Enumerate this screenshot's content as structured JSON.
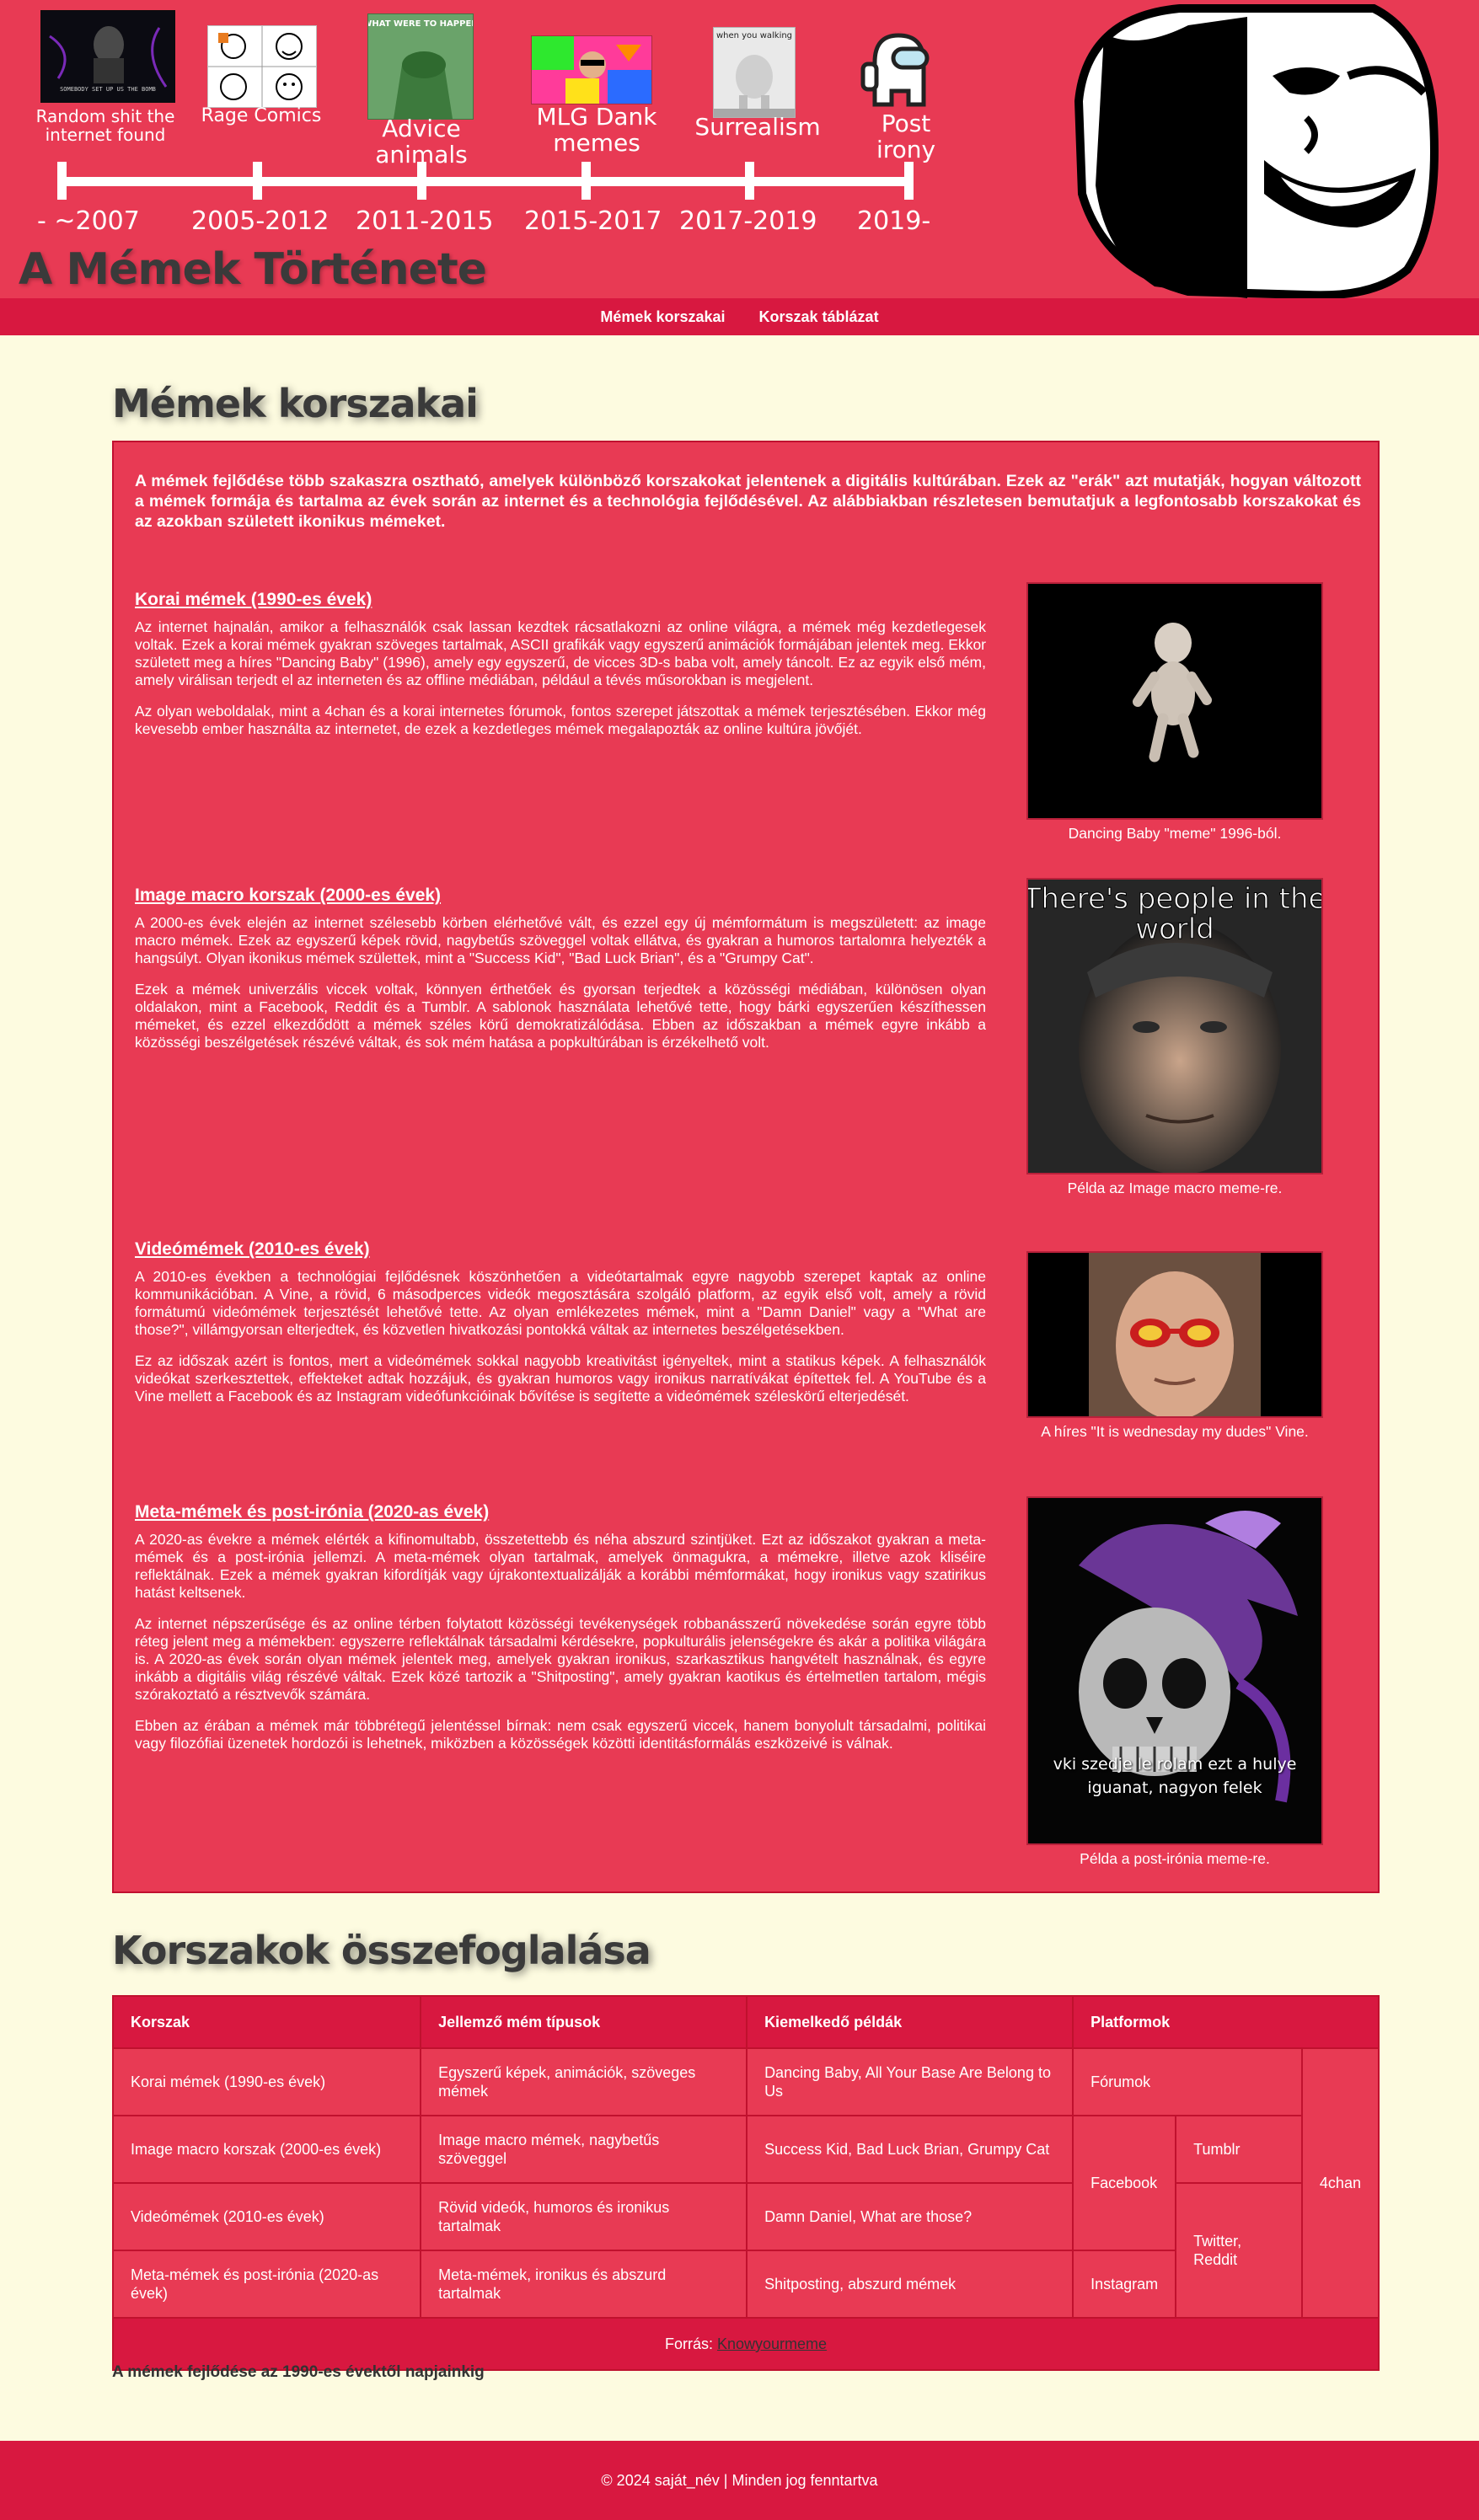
{
  "header": {
    "site_title": "A Mémek Története",
    "timeline": [
      {
        "label": "Random shit the internet found",
        "year": "- ~2007",
        "thumb_caption": "SOMEBODY SET UP US THE BOMB"
      },
      {
        "label": "Rage Comics",
        "year": "2005-2012"
      },
      {
        "label": "Advice animals",
        "year": "2011-2015",
        "thumb_caption": "WHAT WERE TO HAPPEN"
      },
      {
        "label": "MLG Dank memes",
        "year": "2015-2017"
      },
      {
        "label": "Surrealism",
        "year": "2017-2019",
        "thumb_caption": "when you walking"
      },
      {
        "label": "Post irony",
        "year": "2019-"
      }
    ]
  },
  "nav": {
    "items": [
      "Mémek korszakai",
      "Korszak táblázat"
    ]
  },
  "eras_section": {
    "title": "Mémek korszakai",
    "intro": "A mémek fejlődése több szakaszra osztható, amelyek különböző korszakokat jelentenek a digitális kultúrában. Ezek az \"erák\" azt mutatják, hogyan változott a mémek formája és tartalma az évek során az internet és a technológia fejlődésével. Az alábbiakban részletesen bemutatjuk a legfontosabb korszakokat és az azokban született ikonikus mémeket.",
    "eras": [
      {
        "heading": "Korai mémek (1990-es évek)",
        "paragraphs": [
          "Az internet hajnalán, amikor a felhasználók csak lassan kezdtek rácsatlakozni az online világra, a mémek még kezdetlegesek voltak. Ezek a korai mémek gyakran szöveges tartalmak, ASCII grafikák vagy egyszerű animációk formájában jelentek meg. Ekkor született meg a híres \"Dancing Baby\" (1996), amely egy egyszerű, de vicces 3D-s baba volt, amely táncolt. Ez az egyik első mém, amely virálisan terjedt el az interneten és az offline médiában, például a tévés műsorokban is megjelent.",
          "Az olyan weboldalak, mint a 4chan és a korai internetes fórumok, fontos szerepet játszottak a mémek terjesztésében. Ekkor még kevesebb ember használta az internetet, de ezek a kezdetleges mémek megalapozták az online kultúra jövőjét."
        ],
        "caption": "Dancing Baby \"meme\" 1996-ból."
      },
      {
        "heading": "Image macro korszak (2000-es évek)",
        "paragraphs": [
          "A 2000-es évek elején az internet szélesebb körben elérhetővé vált, és ezzel egy új mémformátum is megszületett: az image macro mémek. Ezek az egyszerű képek rövid, nagybetűs szöveggel voltak ellátva, és gyakran a humoros tartalomra helyezték a hangsúlyt. Olyan ikonikus mémek születtek, mint a \"Success Kid\", \"Bad Luck Brian\", és a \"Grumpy Cat\".",
          "Ezek a mémek univerzális viccek voltak, könnyen érthetőek és gyorsan terjedtek a közösségi médiában, különösen olyan oldalakon, mint a Facebook, Reddit és a Tumblr. A sablonok használata lehetővé tette, hogy bárki egyszerűen készíthessen mémeket, és ezzel elkezdődött a mémek széles körű demokratizálódása. Ebben az időszakban a mémek egyre inkább a közösségi beszélgetések részévé váltak, és sok mém hatása a popkultúrában is érzékelhető volt."
        ],
        "caption": "Példa az Image macro meme-re.",
        "image_text": "There's people in the world"
      },
      {
        "heading": "Videómémek (2010-es évek)",
        "paragraphs": [
          "A 2010-es években a technológiai fejlődésnek köszönhetően a videótartalmak egyre nagyobb szerepet kaptak az online kommunikációban. A Vine, a rövid, 6 másodperces videók megosztására szolgáló platform, az egyik első volt, amely a rövid formátumú videómémek terjesztését lehetővé tette. Az olyan emlékezetes mémek, mint a \"Damn Daniel\" vagy a \"What are those?\", villámgyorsan elterjedtek, és közvetlen hivatkozási pontokká váltak az internetes beszélgetésekben.",
          "Ez az időszak azért is fontos, mert a videómémek sokkal nagyobb kreativitást igényeltek, mint a statikus képek. A felhasználók videókat szerkesztettek, effekteket adtak hozzájuk, és gyakran humoros vagy ironikus narratívákat építettek fel. A YouTube és a Vine mellett a Facebook és az Instagram videófunkcióinak bővítése is segítette a videómémek széleskörű elterjedését."
        ],
        "caption": "A híres \"It is wednesday my dudes\" Vine."
      },
      {
        "heading": "Meta-mémek és post-irónia (2020-as évek)",
        "paragraphs": [
          "A 2020-as évekre a mémek elérték a kifinomultabb, összetettebb és néha abszurd szintjüket. Ezt az időszakot gyakran a meta-mémek és a post-irónia jellemzi. A meta-mémek olyan tartalmak, amelyek önmagukra, a mémekre, illetve azok kliséire reflektálnak. Ezek a mémek gyakran kifordítják vagy újrakontextualizálják a korábbi mémformákat, hogy ironikus vagy szatirikus hatást keltsenek.",
          "Az internet népszerűsége és az online térben folytatott közösségi tevékenységek robbanásszerű növekedése során egyre több réteg jelent meg a mémekben: egyszerre reflektálnak társadalmi kérdésekre, popkulturális jelenségekre és akár a politika világára is. A 2020-as évek során olyan mémek jelentek meg, amelyek gyakran ironikus, szarkasztikus hangvételt használnak, és egyre inkább a digitális világ részévé váltak. Ezek közé tartozik a \"Shitposting\", amely gyakran kaotikus és értelmetlen tartalom, mégis szórakoztató a résztvevők számára.",
          "Ebben az érában a mémek már többrétegű jelentéssel bírnak: nem csak egyszerű viccek, hanem bonyolult társadalmi, politikai vagy filozófiai üzenetek hordozói is lehetnek, miközben a közösségek közötti identitásformálás eszközeivé is válnak."
        ],
        "caption": "Példa a post-irónia meme-re.",
        "image_text": "vki szedje le rolam ezt a hulye iguanat, nagyon felek"
      }
    ]
  },
  "summary_section": {
    "title": "Korszakok összefoglalása",
    "columns": [
      "Korszak",
      "Jellemző mém típusok",
      "Kiemelkedő példák",
      "Platformok"
    ],
    "rows": [
      {
        "era": "Korai mémek (1990-es évek)",
        "types": "Egyszerű képek, animációk, szöveges mémek",
        "examples": "Dancing Baby, All Your Base Are Belong to Us"
      },
      {
        "era": "Image macro korszak (2000-es évek)",
        "types": "Image macro mémek, nagybetűs szöveggel",
        "examples": "Success Kid, Bad Luck Brian, Grumpy Cat"
      },
      {
        "era": "Videómémek (2010-es évek)",
        "types": "Rövid videók, humoros és ironikus tartalmak",
        "examples": "Damn Daniel, What are those?"
      },
      {
        "era": "Meta-mémek és post-irónia (2020-as évek)",
        "types": "Meta-mémek, ironikus és abszurd tartalmak",
        "examples": "Shitposting, abszurd mémek"
      }
    ],
    "platforms": {
      "forums": "Fórumok",
      "facebook": "Facebook",
      "tumblr": "Tumblr",
      "twitter_reddit": "Twitter, Reddit",
      "instagram": "Instagram",
      "fourchan": "4chan"
    },
    "source_label": "Forrás:",
    "source_link": "Knowyourmeme",
    "caption": "A mémek fejlődése az 1990-es évektől napjainkig"
  },
  "footer": {
    "text": "© 2024 saját_név | Minden jog fenntartva"
  }
}
